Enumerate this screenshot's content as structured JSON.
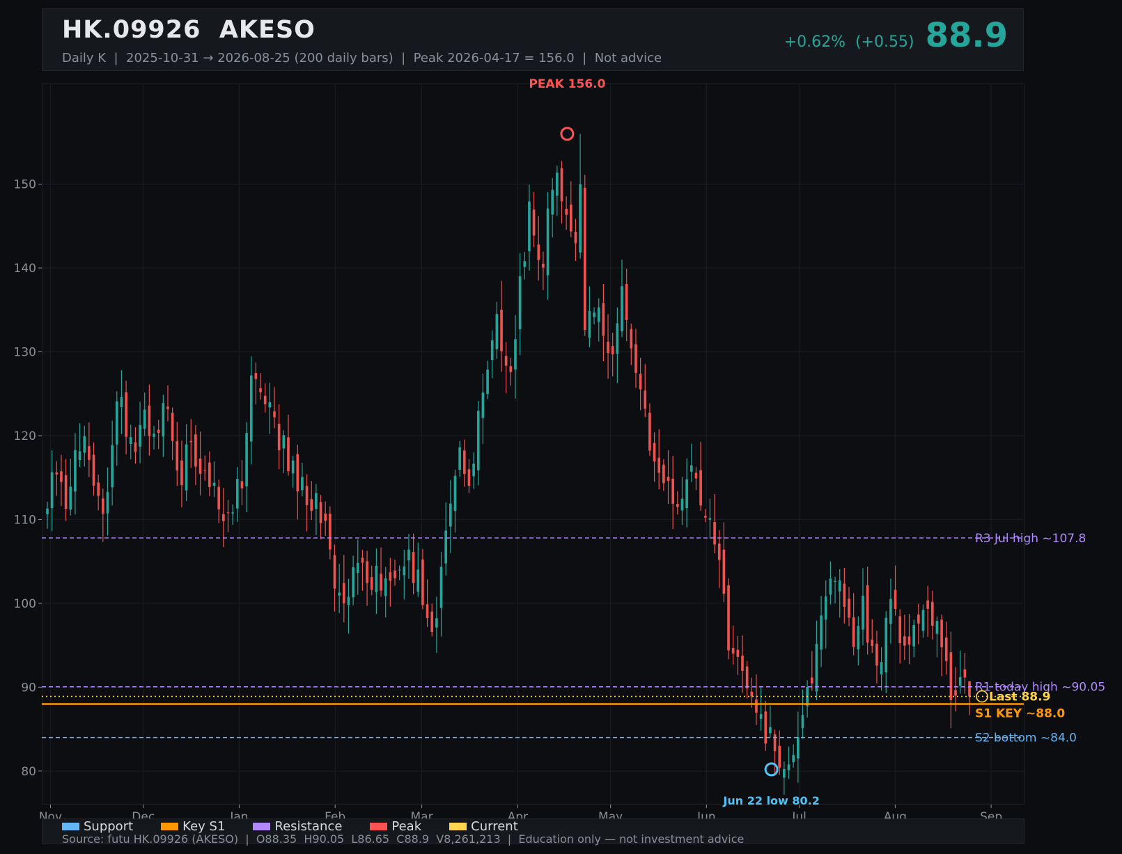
{
  "header": {
    "title": "HK.09926  AKESO",
    "subtitle": "Daily K  |  2025-10-31 → 2026-08-25 (200 daily bars)  |  Peak 2026-04-17 = 156.0  |  Not advice",
    "change": "+0.62%  (+0.55)",
    "price": "88.9"
  },
  "colors": {
    "up": "#26a69a",
    "down": "#ef5350",
    "support": "#64b5f6",
    "key_s1": "#ff9800",
    "resistance": "#b388ff",
    "peak": "#ff5252",
    "current": "#ffd54f",
    "low_marker": "#4fc3f7"
  },
  "legend": [
    {
      "label": "Support",
      "color": "#64b5f6"
    },
    {
      "label": "Key S1",
      "color": "#ff9800"
    },
    {
      "label": "Resistance",
      "color": "#b388ff"
    },
    {
      "label": "Peak",
      "color": "#ff5252"
    },
    {
      "label": "Current",
      "color": "#ffd54f"
    }
  ],
  "footer": {
    "source": "Source: futu HK.09926 (AKESO)  |  O88.35  H90.05  L86.65  C88.9  V8,261,213  |  Education only — not investment advice"
  },
  "chart_data": {
    "type": "candlestick",
    "ylim": [
      76,
      162
    ],
    "yticks": [
      80,
      90,
      100,
      110,
      120,
      130,
      140,
      150
    ],
    "x_months": [
      {
        "label": "Nov",
        "date": "2025-11-01"
      },
      {
        "label": "Dec",
        "date": "2025-12-01"
      },
      {
        "label": "Jan",
        "date": "2026-01-01"
      },
      {
        "label": "Feb",
        "date": "2026-02-01"
      },
      {
        "label": "Mar",
        "date": "2026-03-01"
      },
      {
        "label": "Apr",
        "date": "2026-04-01"
      },
      {
        "label": "May",
        "date": "2026-05-01"
      },
      {
        "label": "Jun",
        "date": "2026-06-01"
      },
      {
        "label": "Jul",
        "date": "2026-07-01"
      },
      {
        "label": "Aug",
        "date": "2026-08-01"
      },
      {
        "label": "Sep",
        "date": "2026-09-01"
      }
    ],
    "date_range": [
      "2025-10-31",
      "2026-08-25"
    ],
    "bar_count": 200,
    "close_path": [
      113,
      117,
      112,
      116,
      120,
      114,
      111,
      116,
      125,
      119,
      118,
      122,
      120,
      125,
      118,
      116,
      119,
      117,
      116,
      113,
      111,
      113,
      116,
      128,
      124,
      122,
      119,
      117,
      115,
      113,
      112,
      110,
      101,
      100,
      103,
      105,
      104,
      102,
      103,
      105,
      106,
      104,
      100,
      96,
      103,
      112,
      117,
      113,
      121,
      128,
      134,
      130,
      128,
      140,
      148,
      139,
      146,
      150,
      145,
      144,
      131,
      136,
      134,
      127,
      138,
      131,
      127,
      120,
      117,
      116,
      111,
      113,
      118,
      112,
      110,
      106,
      96,
      92,
      89,
      86,
      85,
      84,
      80.2,
      83,
      85,
      90,
      96,
      100,
      104,
      98,
      95,
      100,
      95,
      92,
      101,
      97,
      94,
      96,
      98,
      99,
      96,
      89,
      91,
      88.9
    ],
    "levels": [
      {
        "value": 107.8,
        "label": "R3 Jul high ~107.8",
        "kind": "resistance"
      },
      {
        "value": 90.05,
        "label": "R1 today high ~90.05",
        "kind": "resistance"
      },
      {
        "value": 88.9,
        "label": "Last 88.9",
        "kind": "current"
      },
      {
        "value": 88.0,
        "label": "S1 KEY ~88.0",
        "kind": "key_s1"
      },
      {
        "value": 84.0,
        "label": "S2 bottom ~84.0",
        "kind": "support"
      }
    ],
    "annotations": [
      {
        "label": "PEAK 156.0",
        "date": "2026-04-17",
        "value": 156.0,
        "kind": "peak"
      },
      {
        "label": "Jun 22 low 80.2",
        "date": "2026-06-22",
        "value": 80.2,
        "kind": "low"
      }
    ]
  }
}
